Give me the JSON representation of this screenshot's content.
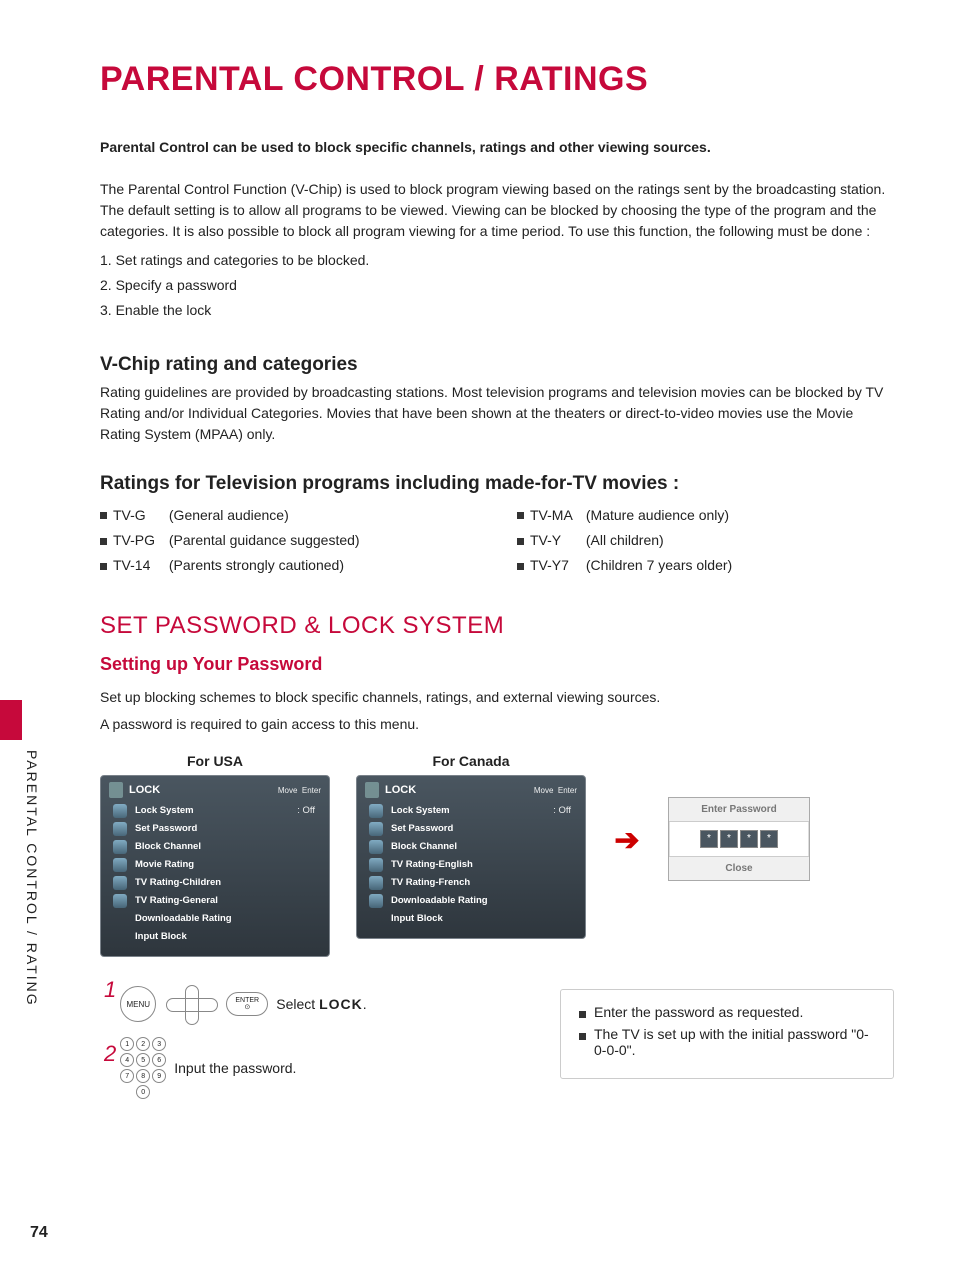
{
  "page_number": "74",
  "side_tab_text": "PARENTAL CONTROL / RATING",
  "title": "PARENTAL CONTROL / RATINGS",
  "lead": "Parental Control can be used to block specific channels, ratings and other viewing sources.",
  "intro": "The Parental Control Function (V-Chip) is used to block program viewing based on the ratings sent by the broadcasting station. The default setting is to allow all programs to be viewed. Viewing can be blocked by choosing the type of the program and the categories. It is also possible to block all program viewing for a time period. To use this function, the following must be done :",
  "intro_steps": [
    "1. Set ratings and categories to be blocked.",
    "2. Specify a password",
    "3. Enable the lock"
  ],
  "vchip_heading": "V-Chip rating and categories",
  "vchip_body": "Rating guidelines are provided by broadcasting stations. Most television programs and television movies can be blocked by TV Rating and/or Individual Categories. Movies that have been shown at the theaters or direct-to-video movies use the Movie Rating System (MPAA) only.",
  "ratings_heading": "Ratings for Television programs including made-for-TV movies :",
  "ratings_left": [
    {
      "code": "TV-G",
      "desc": "(General audience)"
    },
    {
      "code": "TV-PG",
      "desc": "(Parental guidance suggested)"
    },
    {
      "code": "TV-14",
      "desc": "(Parents strongly cautioned)"
    }
  ],
  "ratings_right": [
    {
      "code": "TV-MA",
      "desc": "(Mature audience only)"
    },
    {
      "code": "TV-Y",
      "desc": "(All children)"
    },
    {
      "code": "TV-Y7",
      "desc": "(Children 7 years older)"
    }
  ],
  "set_pw_heading": "SET PASSWORD & LOCK SYSTEM",
  "setup_pw_heading": "Setting up Your Password",
  "setup_pw_body1": "Set up blocking schemes to block specific channels, ratings, and external viewing sources.",
  "setup_pw_body2": "A password is required to gain access to this menu.",
  "menu_captions": {
    "usa": "For USA",
    "canada": "For Canada"
  },
  "menu_header": {
    "title": "LOCK",
    "move": "Move",
    "enter": "Enter"
  },
  "menu_usa_items": [
    {
      "label": "Lock System",
      "state": ": Off"
    },
    {
      "label": "Set Password",
      "state": ""
    },
    {
      "label": "Block Channel",
      "state": ""
    },
    {
      "label": "Movie Rating",
      "state": ""
    },
    {
      "label": "TV Rating-Children",
      "state": ""
    },
    {
      "label": "TV Rating-General",
      "state": ""
    },
    {
      "label": "Downloadable Rating",
      "state": ""
    },
    {
      "label": "Input Block",
      "state": ""
    }
  ],
  "menu_can_items": [
    {
      "label": "Lock System",
      "state": ": Off"
    },
    {
      "label": "Set Password",
      "state": ""
    },
    {
      "label": "Block Channel",
      "state": ""
    },
    {
      "label": "TV Rating-English",
      "state": ""
    },
    {
      "label": "TV Rating-French",
      "state": ""
    },
    {
      "label": "Downloadable Rating",
      "state": ""
    },
    {
      "label": "Input Block",
      "state": ""
    }
  ],
  "pw_dialog": {
    "title": "Enter Password",
    "star": "*",
    "close": "Close"
  },
  "steps": {
    "s1_num": "1",
    "s1_menu": "MENU",
    "s1_enter_top": "ENTER",
    "s1_text_prefix": "Select ",
    "s1_text_lock": "LOCK",
    "s1_text_suffix": ".",
    "s2_num": "2",
    "s2_text": "Input the password."
  },
  "notes": [
    "Enter the password as requested.",
    "The TV is set up with the initial password \"0-0-0-0\"."
  ]
}
